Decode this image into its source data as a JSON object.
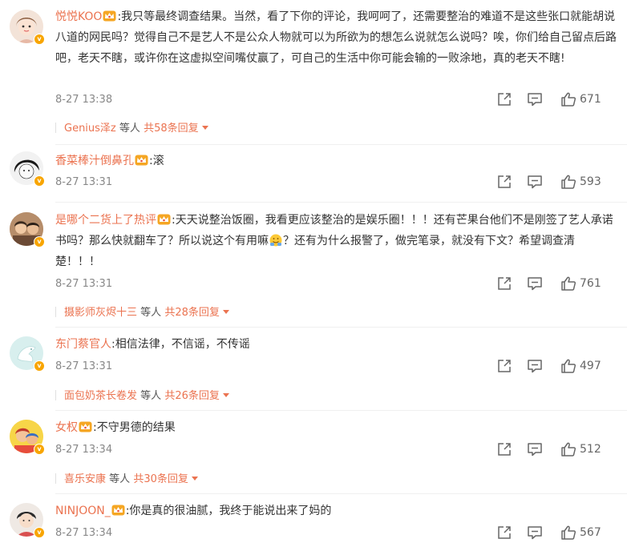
{
  "colors": {
    "accent": "#eb7350",
    "meta": "#888888",
    "badge": "#f8a500"
  },
  "icons": {
    "share": "share-icon",
    "comment": "comment-icon",
    "like": "like-icon",
    "crown": "vip-crown-icon"
  },
  "comments": [
    {
      "user": "悦悦KOO",
      "text": ":我只等最终调查结果。当然，看了下你的评论，我呵呵了，还需要整治的难道不是这些张口就能胡说八道的网民吗？觉得自己不是艺人不是公众人物就可以为所欲为的想怎么说就怎么说吗？唉，你们给自己留点后路吧，老天不瞎，或许你在这虚拟空间嘴仗赢了，可自己的生活中你可能会输的一败涂地，真的老天不瞎!",
      "time": "8-27 13:38",
      "likes": "671",
      "reply": {
        "name": "Genius泽z",
        "middle": "等人",
        "more": "共58条回复"
      }
    },
    {
      "user": "香菜棒汁倒鼻孔",
      "text": ":滚",
      "time": "8-27 13:31",
      "likes": "593"
    },
    {
      "user": "是哪个二货上了热评",
      "text_a": ":天天说整治饭圈，我看更应该整治的是娱乐圈！！！还有芒果台他们不是刚签了艺人承诺书吗？那么快就翻车了？所以说这个有用嘛",
      "text_b": "？还有为什么报警了，做完笔录，就没有下文？希望调查清楚！！！",
      "time": "8-27 13:31",
      "likes": "761",
      "reply": {
        "name": "摄影师灰烬十三",
        "middle": "等人",
        "more": "共28条回复"
      }
    },
    {
      "user": "东门蔡官人",
      "text": ":相信法律，不信谣，不传谣",
      "time": "8-27 13:31",
      "likes": "497",
      "reply": {
        "name": "面包奶茶长卷发",
        "middle": "等人",
        "more": "共26条回复"
      }
    },
    {
      "user": "女权",
      "text": ":不守男德的结果",
      "time": "8-27 13:34",
      "likes": "512",
      "reply": {
        "name": "喜乐安康",
        "middle": "等人",
        "more": "共30条回复"
      }
    },
    {
      "user": "NINJOON_",
      "text": ":你是真的很油腻，我终于能说出来了妈的",
      "time": "8-27 13:34",
      "likes": "567"
    }
  ]
}
